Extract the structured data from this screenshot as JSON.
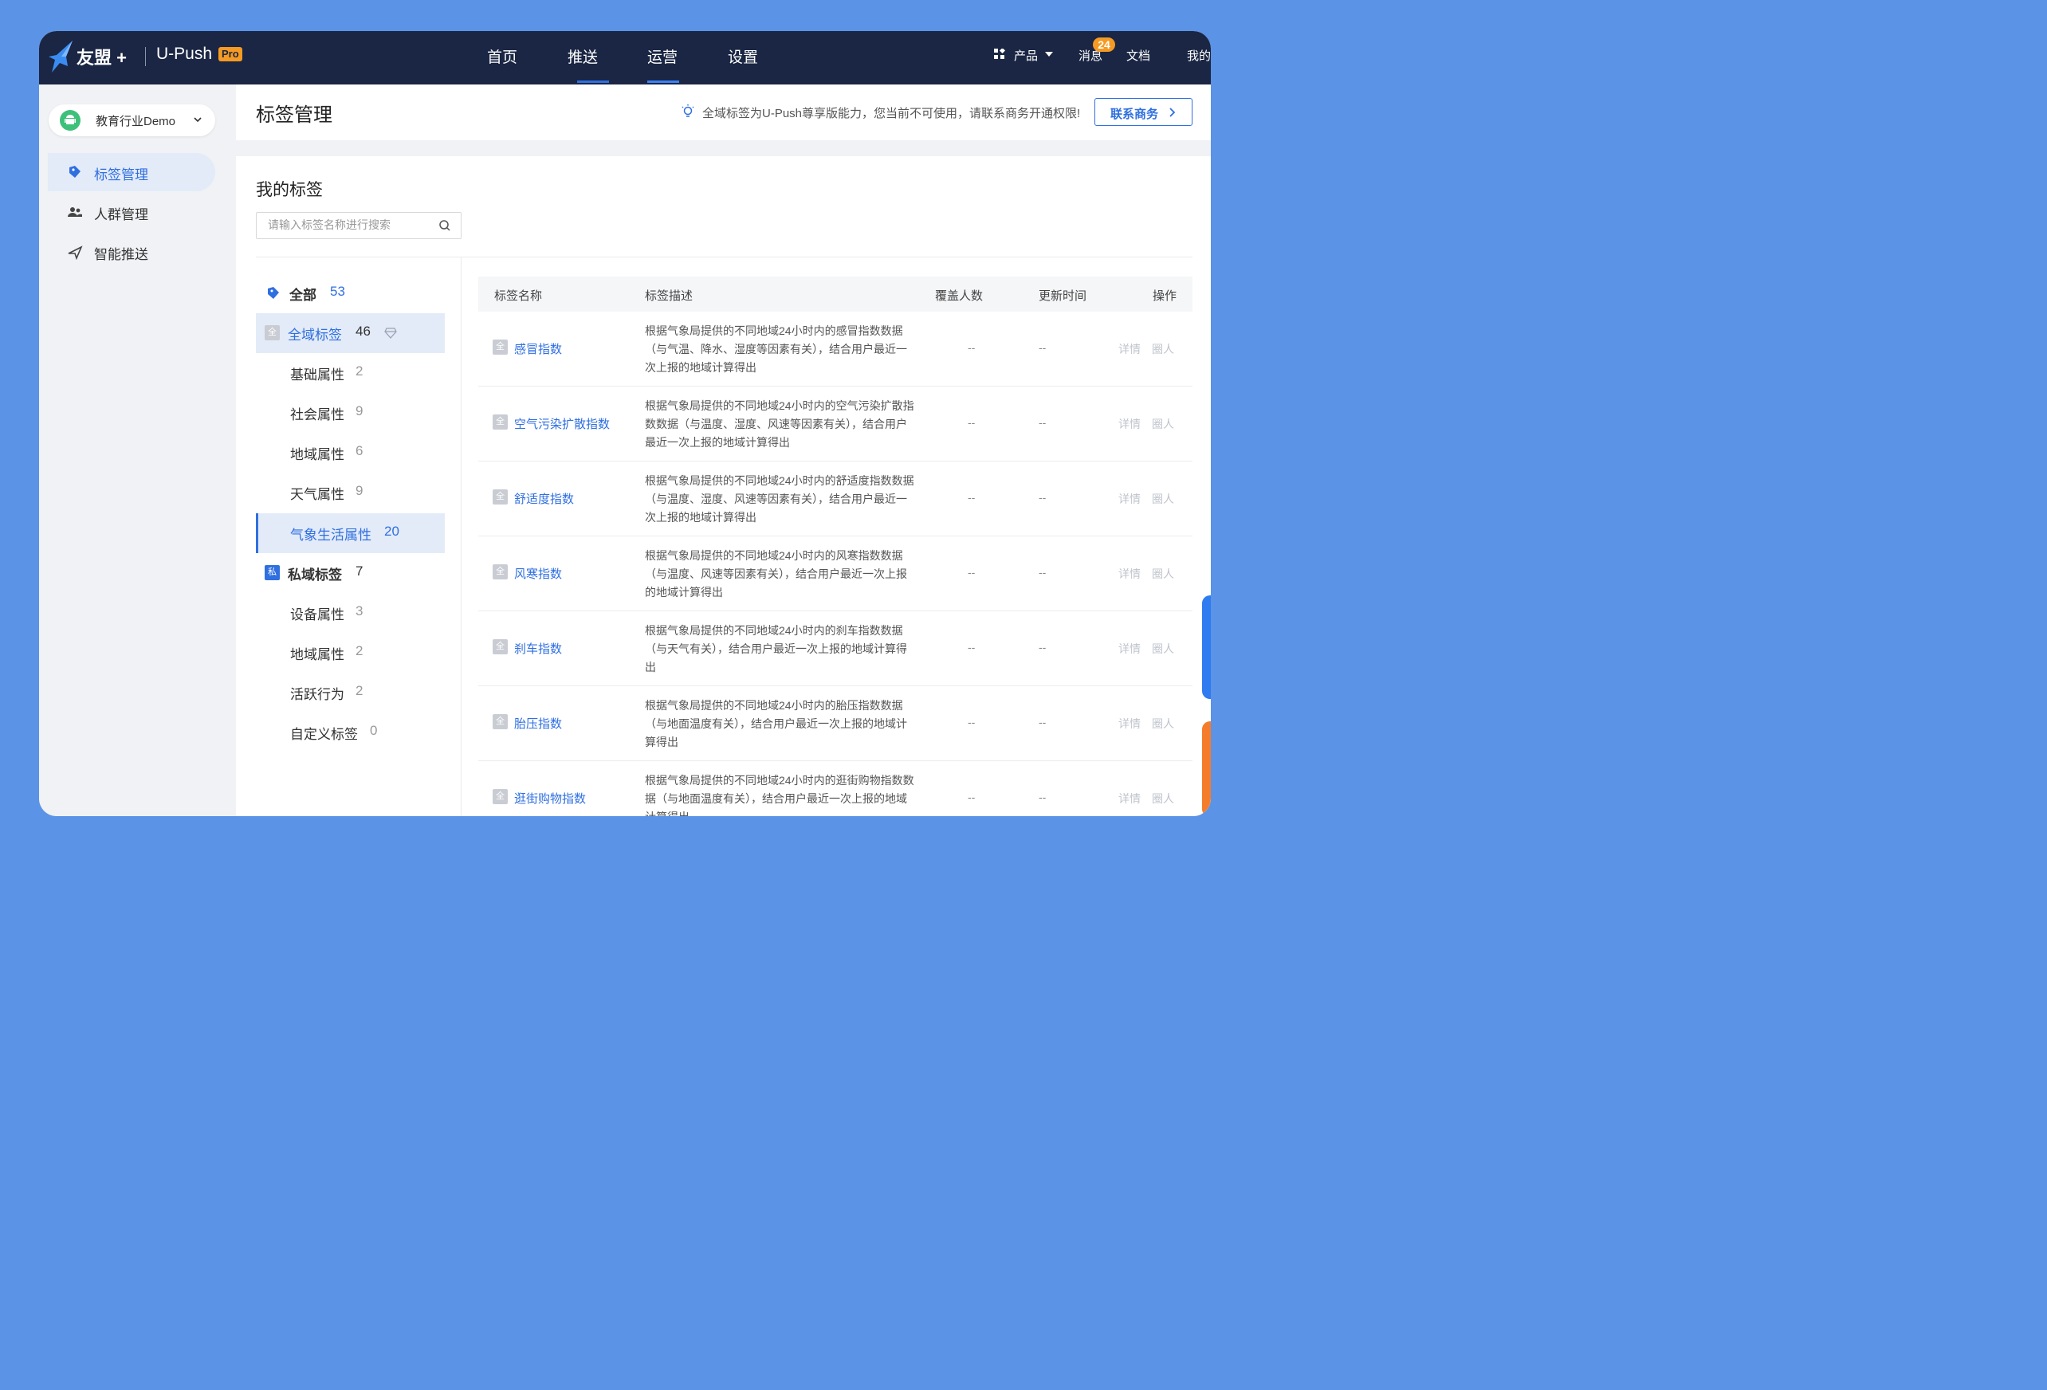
{
  "topnav": {
    "brand": "友盟 +",
    "product": "U-Push",
    "pro_badge": "Pro",
    "links": [
      "首页",
      "推送",
      "运营",
      "设置"
    ],
    "products_label": "产品",
    "messages_label": "消息",
    "messages_count": "24",
    "docs_label": "文档",
    "mine_label": "我的"
  },
  "sidebar": {
    "app_name": "教育行业Demo",
    "items": [
      {
        "label": "标签管理",
        "icon": "tag-icon"
      },
      {
        "label": "人群管理",
        "icon": "users-icon"
      },
      {
        "label": "智能推送",
        "icon": "send-icon"
      }
    ]
  },
  "header": {
    "title": "标签管理",
    "notice": "全域标签为U-Push尊享版能力，您当前不可使用，请联系商务开通权限!",
    "contact_button": "联系商务"
  },
  "tags": {
    "section_title": "我的标签",
    "search_placeholder": "请输入标签名称进行搜索",
    "tree": [
      {
        "label": "全部",
        "count": "53"
      },
      {
        "label": "全域标签",
        "count": "46",
        "badge": "全"
      },
      {
        "label": "基础属性",
        "count": "2"
      },
      {
        "label": "社会属性",
        "count": "9"
      },
      {
        "label": "地域属性",
        "count": "6"
      },
      {
        "label": "天气属性",
        "count": "9"
      },
      {
        "label": "气象生活属性",
        "count": "20"
      },
      {
        "label": "私域标签",
        "count": "7",
        "badge": "私"
      },
      {
        "label": "设备属性",
        "count": "3"
      },
      {
        "label": "地域属性",
        "count": "2"
      },
      {
        "label": "活跃行为",
        "count": "2"
      },
      {
        "label": "自定义标签",
        "count": "0"
      }
    ]
  },
  "table": {
    "columns": [
      "标签名称",
      "标签描述",
      "覆盖人数",
      "更新时间",
      "操作"
    ],
    "badge": "全",
    "rows": [
      {
        "name": "感冒指数",
        "desc": "根据气象局提供的不同地域24小时内的感冒指数数据（与气温、降水、湿度等因素有关），结合用户最近一次上报的地域计算得出",
        "coverage": "--",
        "updated": "--",
        "op1": "详情",
        "op2": "圈人"
      },
      {
        "name": "空气污染扩散指数",
        "desc": "根据气象局提供的不同地域24小时内的空气污染扩散指数数据（与温度、湿度、风速等因素有关），结合用户最近一次上报的地域计算得出",
        "coverage": "--",
        "updated": "--",
        "op1": "详情",
        "op2": "圈人"
      },
      {
        "name": "舒适度指数",
        "desc": "根据气象局提供的不同地域24小时内的舒适度指数数据（与温度、湿度、风速等因素有关），结合用户最近一次上报的地域计算得出",
        "coverage": "--",
        "updated": "--",
        "op1": "详情",
        "op2": "圈人"
      },
      {
        "name": "风寒指数",
        "desc": "根据气象局提供的不同地域24小时内的风寒指数数据（与温度、风速等因素有关），结合用户最近一次上报的地域计算得出",
        "coverage": "--",
        "updated": "--",
        "op1": "详情",
        "op2": "圈人"
      },
      {
        "name": "刹车指数",
        "desc": "根据气象局提供的不同地域24小时内的刹车指数数据（与天气有关），结合用户最近一次上报的地域计算得出",
        "coverage": "--",
        "updated": "--",
        "op1": "详情",
        "op2": "圈人"
      },
      {
        "name": "胎压指数",
        "desc": "根据气象局提供的不同地域24小时内的胎压指数数据（与地面温度有关），结合用户最近一次上报的地域计算得出",
        "coverage": "--",
        "updated": "--",
        "op1": "详情",
        "op2": "圈人"
      },
      {
        "name": "逛街购物指数",
        "desc": "根据气象局提供的不同地域24小时内的逛街购物指数数据（与地面温度有关），结合用户最近一次上报的地域计算得出",
        "coverage": "--",
        "updated": "--",
        "op1": "详情",
        "op2": "圈人"
      }
    ]
  },
  "colors": {
    "accent": "#2f6fe0",
    "nav_bg": "#1a2643",
    "badge": "#f59a23"
  }
}
